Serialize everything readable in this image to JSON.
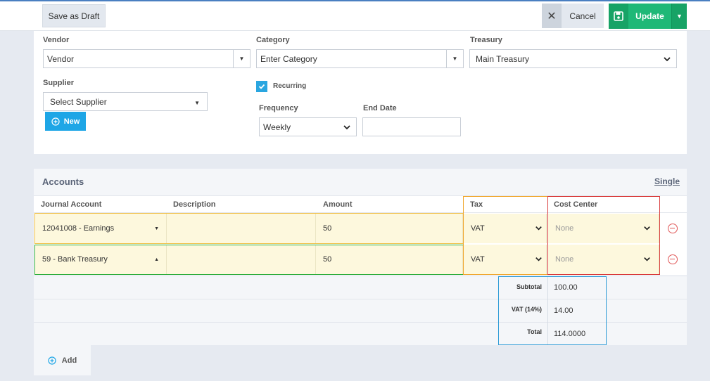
{
  "toolbar": {
    "save_draft_label": "Save as Draft",
    "cancel_label": "Cancel",
    "update_label": "Update"
  },
  "form": {
    "vendor": {
      "label": "Vendor",
      "value": "Vendor"
    },
    "category": {
      "label": "Category",
      "placeholder": "Enter Category"
    },
    "treasury": {
      "label": "Treasury",
      "value": "Main Treasury"
    },
    "supplier": {
      "label": "Supplier",
      "value": "Select Supplier"
    },
    "new_label": "New",
    "recurring": {
      "label": "Recurring",
      "checked": true
    },
    "frequency": {
      "label": "Frequency",
      "value": "Weekly"
    },
    "end_date": {
      "label": "End Date",
      "value": ""
    }
  },
  "accounts": {
    "title": "Accounts",
    "single_link": "Single",
    "columns": [
      "Journal Account",
      "Description",
      "Amount",
      "Tax",
      "Cost Center"
    ],
    "rows": [
      {
        "account": "12041008 - Earnings",
        "description": "",
        "amount": "50",
        "tax": "VAT",
        "cost_center": "None"
      },
      {
        "account": "59 - Bank Treasury",
        "description": "",
        "amount": "50",
        "tax": "VAT",
        "cost_center": "None"
      }
    ],
    "summary": [
      {
        "label": "Subtotal",
        "value": "100.00"
      },
      {
        "label": "VAT (14%)",
        "value": "14.00"
      },
      {
        "label": "Total",
        "value": "114.0000"
      }
    ],
    "add_label": "Add"
  },
  "colors": {
    "accent": "#1ea6e6",
    "update": "#1fb877",
    "delete": "#e05656",
    "row_highlight": "#fdf8dd",
    "outline_orange": "#f0a830",
    "outline_green": "#2eae3c",
    "outline_red": "#d93a3a",
    "outline_blue": "#2a9ad6"
  }
}
